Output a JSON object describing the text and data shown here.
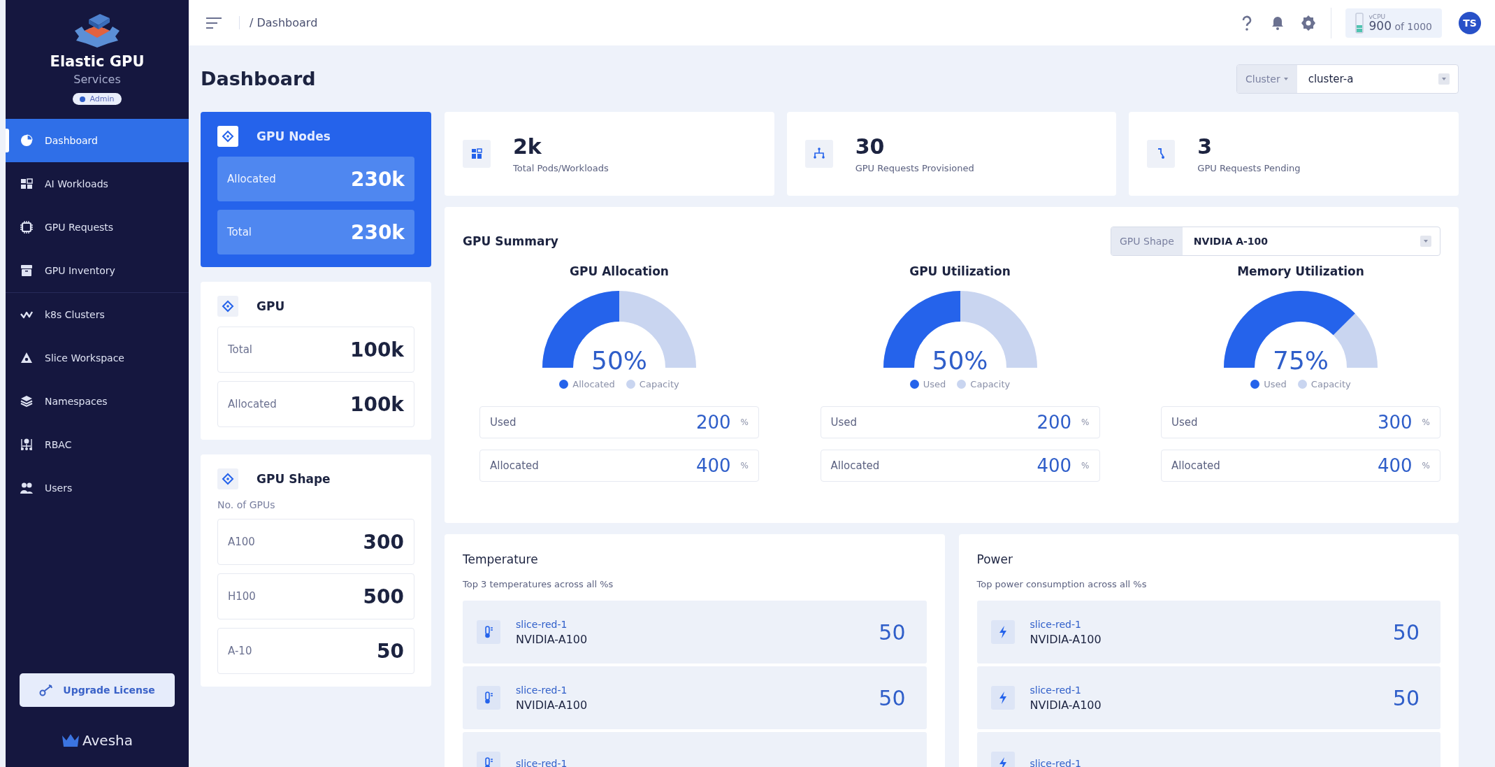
{
  "sidebar": {
    "brand": {
      "title": "Elastic GPU",
      "subtitle": "Services",
      "role": "Admin"
    },
    "items": [
      {
        "label": "Dashboard",
        "selected": true
      },
      {
        "label": "AI Workloads",
        "selected": false
      },
      {
        "label": "GPU Requests",
        "selected": false
      },
      {
        "label": "GPU Inventory",
        "selected": false
      },
      {
        "label": "k8s Clusters",
        "selected": false
      },
      {
        "label": "Slice Workspace",
        "selected": false
      },
      {
        "label": "Namespaces",
        "selected": false
      },
      {
        "label": "RBAC",
        "selected": false
      },
      {
        "label": "Users",
        "selected": false
      }
    ],
    "upgrade_button": "Upgrade License",
    "footer_logo": "Avesha"
  },
  "topbar": {
    "breadcrumb": "/ Dashboard",
    "vcpu": {
      "label": "vCPU",
      "value": "900",
      "total": "of 1000"
    },
    "avatar": "TS"
  },
  "page_title": "Dashboard",
  "cluster_select": {
    "label": "Cluster",
    "value": "cluster-a"
  },
  "left_cards": [
    {
      "title": "GPU Nodes",
      "highlighted": true,
      "rows": [
        {
          "label": "Allocated",
          "value": "230k"
        },
        {
          "label": "Total",
          "value": "230k"
        }
      ]
    },
    {
      "title": "GPU",
      "highlighted": false,
      "rows": [
        {
          "label": "Total",
          "value": "100k"
        },
        {
          "label": "Allocated",
          "value": "100k"
        }
      ]
    },
    {
      "title": "GPU Shape",
      "highlighted": false,
      "subtitle": "No. of GPUs",
      "rows": [
        {
          "label": "A100",
          "value": "300"
        },
        {
          "label": "H100",
          "value": "500"
        },
        {
          "label": "A-10",
          "value": "50"
        }
      ]
    }
  ],
  "stats": [
    {
      "value": "2k",
      "label": "Total Pods/Workloads"
    },
    {
      "value": "30",
      "label": "GPU Requests Provisioned"
    },
    {
      "value": "3",
      "label": "GPU Requests Pending"
    }
  ],
  "gpu_summary": {
    "title": "GPU Summary",
    "shape_select": {
      "label": "GPU Shape",
      "value": "NVIDIA A-100"
    },
    "gauges": [
      {
        "title": "GPU Allocation",
        "reading": "50%",
        "legend": [
          {
            "label": "Allocated",
            "color": "#2563eb"
          },
          {
            "label": "Capacity",
            "color": "#c9d5f0"
          }
        ],
        "rows": [
          {
            "label": "Used",
            "value": "200",
            "unit": "%"
          },
          {
            "label": "Allocated",
            "value": "400",
            "unit": "%"
          }
        ]
      },
      {
        "title": "GPU Utilization",
        "reading": "50%",
        "legend": [
          {
            "label": "Used",
            "color": "#2563eb"
          },
          {
            "label": "Capacity",
            "color": "#c9d5f0"
          }
        ],
        "rows": [
          {
            "label": "Used",
            "value": "200",
            "unit": "%"
          },
          {
            "label": "Allocated",
            "value": "400",
            "unit": "%"
          }
        ]
      },
      {
        "title": "Memory Utilization",
        "reading": "75%",
        "legend": [
          {
            "label": "Used",
            "color": "#2563eb"
          },
          {
            "label": "Capacity",
            "color": "#c9d5f0"
          }
        ],
        "rows": [
          {
            "label": "Used",
            "value": "300",
            "unit": "%"
          },
          {
            "label": "Allocated",
            "value": "400",
            "unit": "%"
          }
        ]
      }
    ]
  },
  "panels": [
    {
      "title": "Temperature",
      "subtitle": "Top 3 temperatures across all %s",
      "kind": "temperature",
      "items": [
        {
          "name": "slice-red-1",
          "model": "NVIDIA-A100",
          "value": "50"
        },
        {
          "name": "slice-red-1",
          "model": "NVIDIA-A100",
          "value": "50"
        },
        {
          "name": "slice-red-1"
        }
      ]
    },
    {
      "title": "Power",
      "subtitle": "Top power consumption across all %s",
      "kind": "power",
      "items": [
        {
          "name": "slice-red-1",
          "model": "NVIDIA-A100",
          "value": "50"
        },
        {
          "name": "slice-red-1",
          "model": "NVIDIA-A100",
          "value": "50"
        },
        {
          "name": "slice-red-1"
        }
      ]
    }
  ]
}
